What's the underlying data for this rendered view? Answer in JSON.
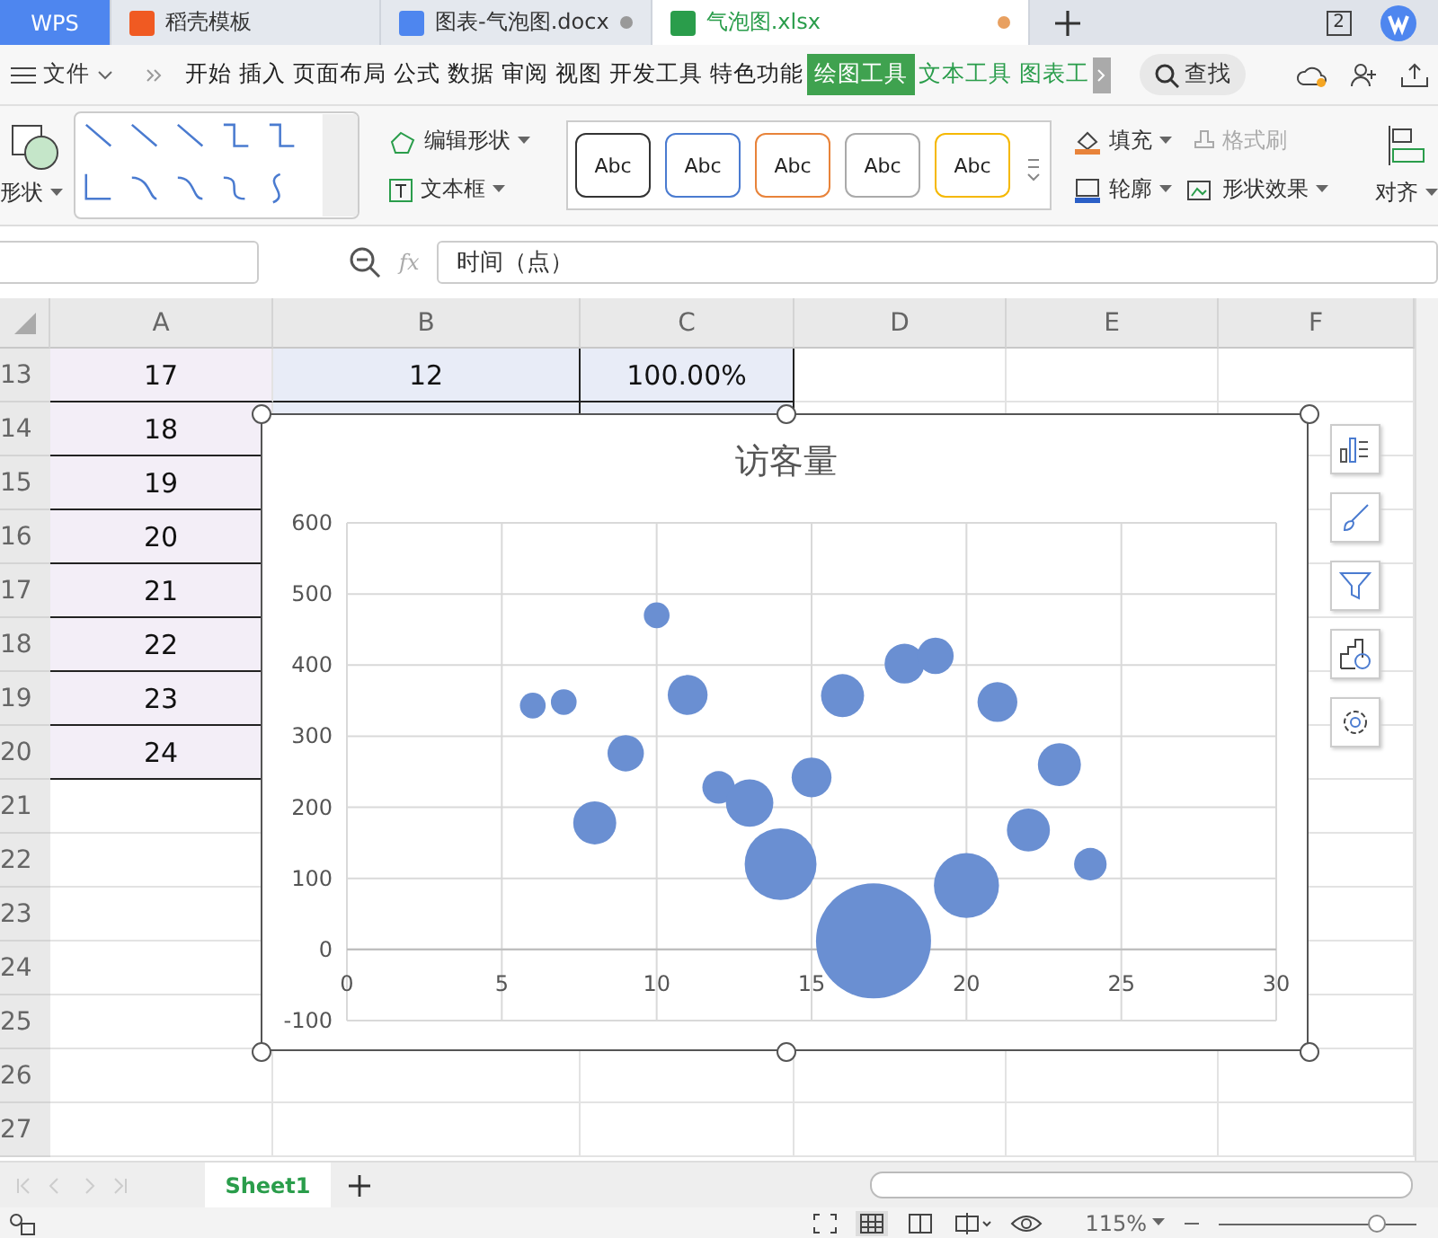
{
  "tabs": [
    {
      "label": "WPS",
      "kind": "brand",
      "selected": false
    },
    {
      "label": "稻壳模板",
      "kind": "docer",
      "selected": false
    },
    {
      "label": "图表-气泡图.docx",
      "kind": "doc",
      "selected": false
    },
    {
      "label": "气泡图.xlsx",
      "kind": "sheet",
      "selected": true
    }
  ],
  "page_indicator": "2",
  "menu": {
    "file": "文件",
    "items": [
      {
        "label": "开始",
        "selected": false,
        "kind": "normal"
      },
      {
        "label": "插入",
        "selected": false,
        "kind": "normal"
      },
      {
        "label": "页面布局",
        "selected": false,
        "kind": "normal"
      },
      {
        "label": "公式",
        "selected": false,
        "kind": "normal"
      },
      {
        "label": "数据",
        "selected": false,
        "kind": "normal"
      },
      {
        "label": "审阅",
        "selected": false,
        "kind": "normal"
      },
      {
        "label": "视图",
        "selected": false,
        "kind": "normal"
      },
      {
        "label": "开发工具",
        "selected": false,
        "kind": "normal"
      },
      {
        "label": "特色功能",
        "selected": false,
        "kind": "normal"
      },
      {
        "label": "绘图工具",
        "selected": true,
        "kind": "context"
      },
      {
        "label": "文本工具",
        "selected": false,
        "kind": "context"
      },
      {
        "label": "图表工",
        "selected": false,
        "kind": "context"
      }
    ],
    "search": "查找"
  },
  "ribbon": {
    "shape": "形状",
    "edit_shape": "编辑形状",
    "text_box": "文本框",
    "styles": [
      {
        "label": "Abc",
        "color": "#333333"
      },
      {
        "label": "Abc",
        "color": "#4a7bd0"
      },
      {
        "label": "Abc",
        "color": "#e8833a"
      },
      {
        "label": "Abc",
        "color": "#aaaaaa"
      },
      {
        "label": "Abc",
        "color": "#f5b800"
      }
    ],
    "fill": "填充",
    "format_painter": {
      "label": "格式刷",
      "disabled": true
    },
    "outline": "轮廓",
    "effects": "形状效果",
    "align": "对齐"
  },
  "formula_bar": {
    "fx": "fx",
    "value": "时间（点）"
  },
  "sheet": {
    "columns": [
      "A",
      "B",
      "C",
      "D",
      "E",
      "F"
    ],
    "rows": [
      {
        "number": "13",
        "cells": [
          "17",
          "12",
          "100.00%"
        ]
      },
      {
        "number": "14",
        "cells": [
          "18"
        ]
      },
      {
        "number": "15",
        "cells": [
          "19"
        ]
      },
      {
        "number": "16",
        "cells": [
          "20"
        ]
      },
      {
        "number": "17",
        "cells": [
          "21"
        ]
      },
      {
        "number": "18",
        "cells": [
          "22"
        ]
      },
      {
        "number": "19",
        "cells": [
          "23"
        ]
      },
      {
        "number": "20",
        "cells": [
          "24"
        ]
      },
      {
        "number": "21",
        "cells": []
      },
      {
        "number": "22",
        "cells": []
      },
      {
        "number": "23",
        "cells": []
      },
      {
        "number": "24",
        "cells": []
      },
      {
        "number": "25",
        "cells": []
      },
      {
        "number": "26",
        "cells": []
      },
      {
        "number": "27",
        "cells": []
      }
    ]
  },
  "chart_data": {
    "type": "scatter",
    "title": "访客量",
    "grid": true,
    "x": [
      6,
      7,
      8,
      9,
      10,
      11,
      12,
      13,
      14,
      15,
      16,
      17,
      18,
      19,
      20,
      21,
      22,
      23,
      24
    ],
    "series": [
      {
        "color": "#6a8fd2",
        "values": [
          343,
          348,
          178,
          276,
          470,
          358,
          228,
          206,
          120,
          242,
          357,
          12,
          402,
          413,
          90,
          348,
          168,
          260,
          120
        ],
        "sizes": [
          0.05,
          0.05,
          0.14,
          0.1,
          0.05,
          0.12,
          0.08,
          0.17,
          0.39,
          0.12,
          0.14,
          1,
          0.12,
          0.1,
          0.32,
          0.12,
          0.14,
          0.14,
          0.08
        ]
      }
    ],
    "xlim": [
      0,
      30
    ],
    "ylim": [
      -100,
      600
    ],
    "xticks": [
      0,
      5,
      10,
      15,
      20,
      25,
      30
    ],
    "yticks": [
      -100,
      0,
      100,
      200,
      300,
      400,
      500,
      600
    ]
  },
  "sheet_tabs": [
    {
      "label": "Sheet1",
      "selected": true
    }
  ],
  "status_bar": {
    "zoom": "115%",
    "zoom_slider": {
      "level": 0.8
    }
  }
}
